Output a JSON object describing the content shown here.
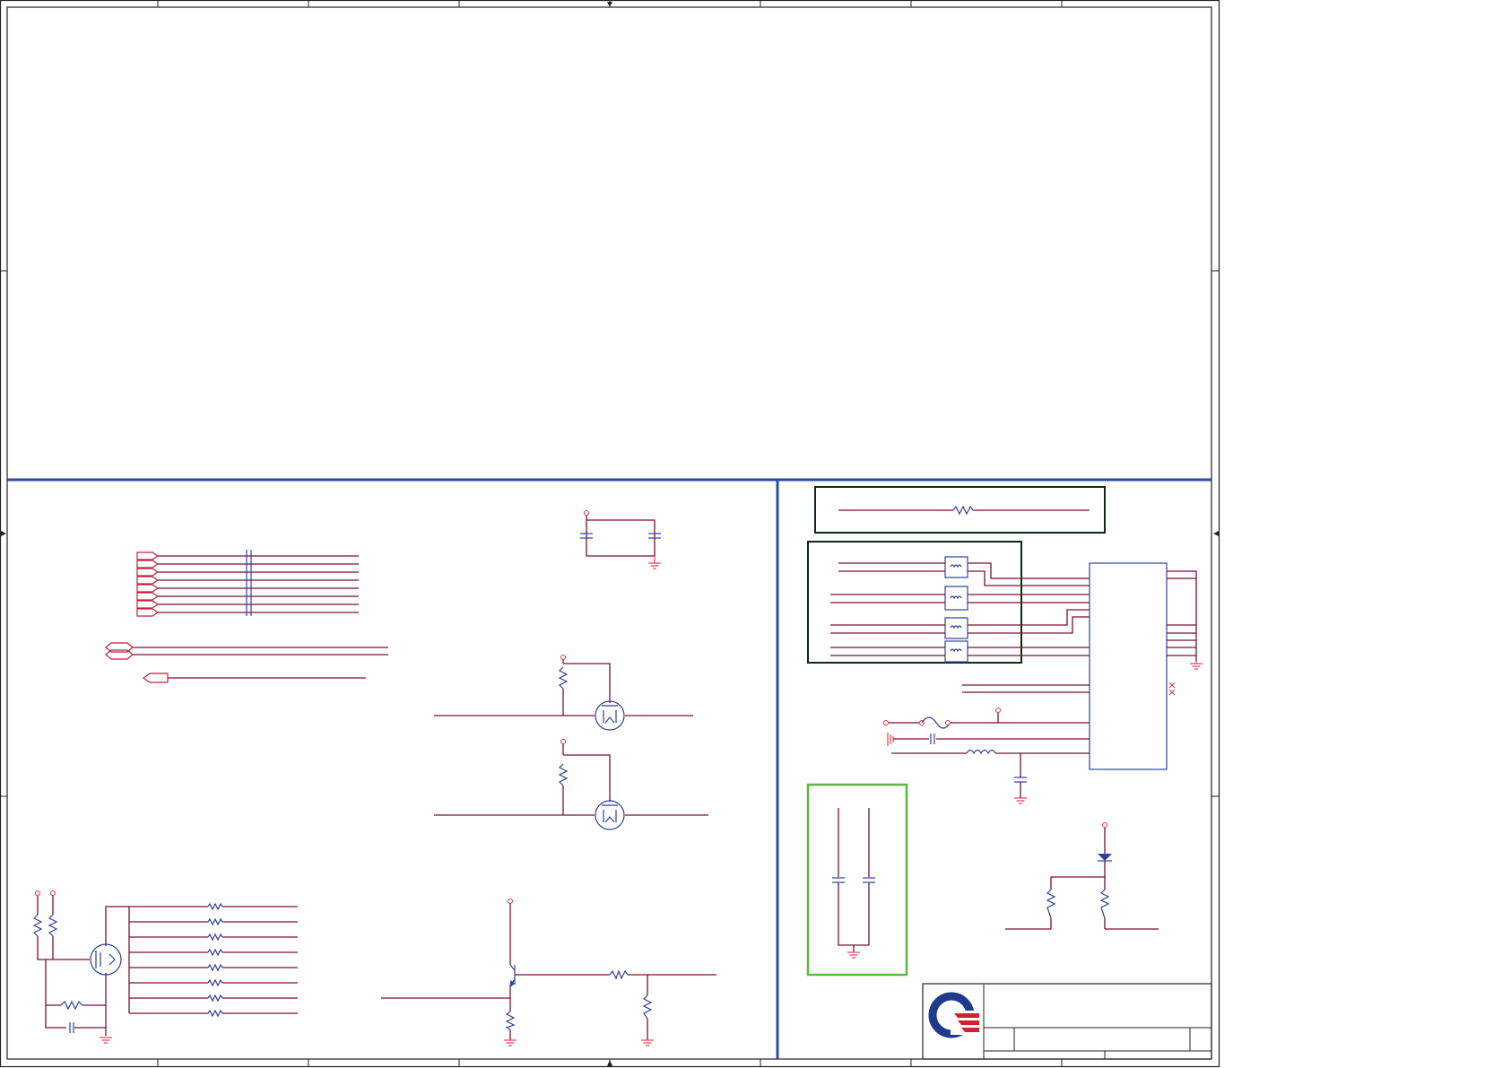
{
  "sheet": {
    "title_block": {
      "company_logo": "company-logo-icon",
      "title": "",
      "rev": ""
    }
  },
  "colors": {
    "wire": "#7a1030",
    "component": "#2e3f9e",
    "pin": "#e03040",
    "divider": "#2e4aa8",
    "dark_box": "#0e2a10",
    "green_box": "#5cb840",
    "logo_blue": "#1f3a8a",
    "logo_red": "#d42030"
  },
  "sections": {
    "top_area": "empty",
    "left_panel": [
      "bus-connectors",
      "mosfet-switches",
      "level-shifter",
      "transistor-driver"
    ],
    "right_panel": [
      "jumper-box",
      "connector-block",
      "fuse-filter",
      "bypass-caps",
      "led-indicator"
    ]
  }
}
